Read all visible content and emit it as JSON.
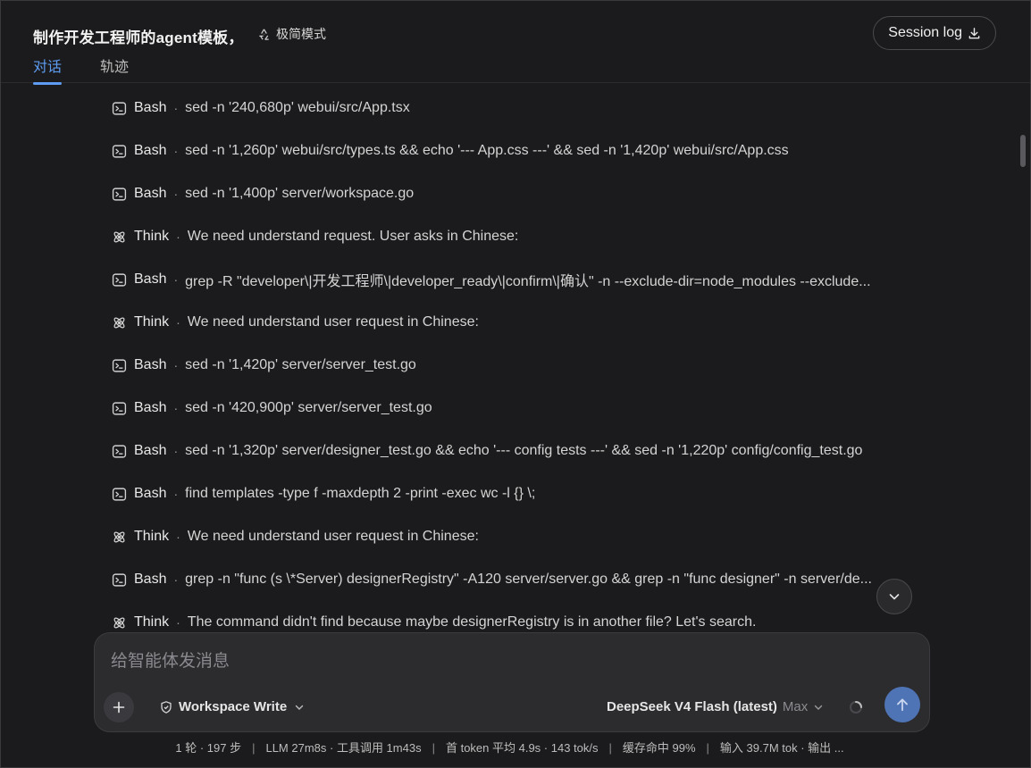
{
  "header": {
    "title": "制作开发工程师的agent模板，",
    "mode_label": "极简模式",
    "session_log_label": "Session log",
    "tabs": [
      {
        "label": "对话",
        "active": true
      },
      {
        "label": "轨迹",
        "active": false
      }
    ]
  },
  "log": [
    {
      "kind": "Bash",
      "icon": "terminal-icon",
      "text": "sed -n '240,680p' webui/src/App.tsx"
    },
    {
      "kind": "Bash",
      "icon": "terminal-icon",
      "text": "sed -n '1,260p' webui/src/types.ts && echo '--- App.css ---' && sed -n '1,420p' webui/src/App.css"
    },
    {
      "kind": "Bash",
      "icon": "terminal-icon",
      "text": "sed -n '1,400p' server/workspace.go"
    },
    {
      "kind": "Think",
      "icon": "atom-icon",
      "text": "We need understand request. User asks in Chinese:"
    },
    {
      "kind": "Bash",
      "icon": "terminal-icon",
      "text": "grep -R \"developer\\|开发工程师\\|developer_ready\\|confirm\\|确认\" -n --exclude-dir=node_modules --exclude..."
    },
    {
      "kind": "Think",
      "icon": "atom-icon",
      "text": "We need understand user request in Chinese:"
    },
    {
      "kind": "Bash",
      "icon": "terminal-icon",
      "text": "sed -n '1,420p' server/server_test.go"
    },
    {
      "kind": "Bash",
      "icon": "terminal-icon",
      "text": "sed -n '420,900p' server/server_test.go"
    },
    {
      "kind": "Bash",
      "icon": "terminal-icon",
      "text": "sed -n '1,320p' server/designer_test.go && echo '--- config tests ---' && sed -n '1,220p' config/config_test.go"
    },
    {
      "kind": "Bash",
      "icon": "terminal-icon",
      "text": "find templates -type f -maxdepth 2 -print -exec wc -l {} \\;"
    },
    {
      "kind": "Think",
      "icon": "atom-icon",
      "text": "We need understand user request in Chinese:"
    },
    {
      "kind": "Bash",
      "icon": "terminal-icon",
      "text": "grep -n \"func (s \\*Server) designerRegistry\" -A120 server/server.go && grep -n \"func designer\" -n server/de..."
    },
    {
      "kind": "Think",
      "icon": "atom-icon",
      "text": "The command didn't find because maybe designerRegistry is in another file? Let's search."
    }
  ],
  "composer": {
    "placeholder": "给智能体发消息",
    "value": "",
    "permission_label": "Workspace Write",
    "model_name": "DeepSeek V4 Flash (latest)",
    "model_level": "Max"
  },
  "status": {
    "turns": "1 轮 · 197 步",
    "timing": "LLM 27m8s · 工具调用 1m43s",
    "first_token": "首 token 平均 4.9s · 143 tok/s",
    "cache": "缓存命中 99%",
    "io": "输入 39.7M tok · 输出 ..."
  },
  "colors": {
    "accent": "#5d9cf0",
    "background": "#1b1b1d",
    "send": "#4f74b5"
  }
}
